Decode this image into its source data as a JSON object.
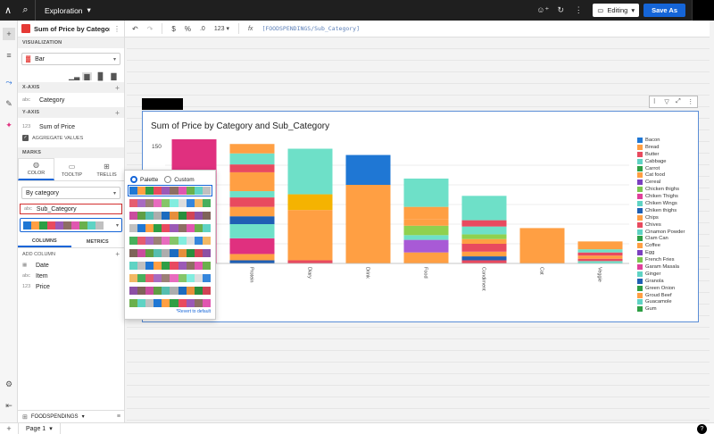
{
  "topbar": {
    "title": "Exploration",
    "mode": "Editing",
    "save": "Save As"
  },
  "toolbar": {
    "format_currency": "$",
    "format_percent": "%",
    "format_number": "123",
    "fx": "fx",
    "formula": "[FOODSPENDINGS/Sub_Category]"
  },
  "panel": {
    "title": "Sum of Price by Category a...",
    "visualization_label": "VISUALIZATION",
    "chart_type": "Bar",
    "xaxis_label": "X-AXIS",
    "xaxis_field_type": "abc",
    "xaxis_field": "Category",
    "yaxis_label": "Y-AXIS",
    "yaxis_field_type": "123",
    "yaxis_field": "Sum of Price",
    "aggregate": "AGGREGATE VALUES",
    "marks_label": "MARKS",
    "tabs": [
      "COLOR",
      "TOOLTIP",
      "TRELLIS"
    ],
    "color_by": "By category",
    "color_field_type": "abc",
    "color_field": "Sub_Category",
    "columns_tab": "COLUMNS",
    "metrics_tab": "METRICS",
    "add_column": "ADD COLUMN",
    "columns": [
      {
        "type": "",
        "name": "Date"
      },
      {
        "type": "abc",
        "name": "Item"
      },
      {
        "type": "123",
        "name": "Price"
      }
    ],
    "source": "FOODSPENDINGS"
  },
  "popup": {
    "palette": "Palette",
    "custom": "Custom",
    "revert": "*Revert to default"
  },
  "bottombar": {
    "page": "Page 1",
    "help": "?"
  },
  "colors": {
    "accent": "#1565d8",
    "selected_palette": [
      "#1f77d4",
      "#ff9f43",
      "#2e9e44",
      "#e84a5f",
      "#9b59b6",
      "#8d6e63",
      "#e056b0",
      "#6ab04c",
      "#5fd3c4",
      "#c0c0c0"
    ]
  },
  "chart_data": {
    "type": "bar",
    "stacked": true,
    "title": "Sum of Price by Category and Sub_Category",
    "ylim": [
      0,
      150
    ],
    "yticks": [
      150
    ],
    "categories": [
      "",
      "Protein",
      "Diary",
      "Drink",
      "Food",
      "Condiment",
      "Cat",
      "Veggie"
    ],
    "legend_entries": [
      "Bacon",
      "Bread",
      "Butter",
      "Cabbage",
      "Carrot",
      "Cat food",
      "Cereal",
      "Chicken thighs",
      "Chiken Thighs",
      "Chiken Wings",
      "Chiken thighs",
      "Chips",
      "Chives",
      "Cinamon Powder",
      "Clam Can",
      "Coffee",
      "Egg",
      "French Fries",
      "Garam Masala",
      "Ginger",
      "Granola",
      "Green Onion",
      "Groud Beef",
      "Guacamole",
      "Gum"
    ],
    "legend_colors": [
      "#1f77d4",
      "#ff9f43",
      "#e84a5f",
      "#5fd3c4",
      "#2e9e44",
      "#ff9f43",
      "#7b3fbf",
      "#7ac74f",
      "#e0409a",
      "#5fd3c4",
      "#1f5fb4",
      "#ff9f43",
      "#e84a5f",
      "#5fd3c4",
      "#2e9e44",
      "#ff9f43",
      "#7b3fbf",
      "#7ac74f",
      "#e0409a",
      "#5fd3c4",
      "#1f5fb4",
      "#2e9e44",
      "#ff9f43",
      "#5fd3c4",
      "#2e9e44"
    ],
    "stacks": [
      [
        {
          "c": "#e0307f",
          "v": 158
        }
      ],
      [
        {
          "c": "#1f5fb4",
          "v": 4
        },
        {
          "c": "#ff9f43",
          "v": 8
        },
        {
          "c": "#e0307f",
          "v": 20
        },
        {
          "c": "#6ee0c8",
          "v": 18
        },
        {
          "c": "#1f5fb4",
          "v": 10
        },
        {
          "c": "#ff9f43",
          "v": 12
        },
        {
          "c": "#e84a5f",
          "v": 12
        },
        {
          "c": "#6ee0c8",
          "v": 8
        },
        {
          "c": "#ff9f43",
          "v": 24
        },
        {
          "c": "#e84a5f",
          "v": 10
        },
        {
          "c": "#6ee0c8",
          "v": 14
        },
        {
          "c": "#ff9f43",
          "v": 12
        }
      ],
      [
        {
          "c": "#e84a5f",
          "v": 4
        },
        {
          "c": "#ff9f43",
          "v": 64
        },
        {
          "c": "#f5b301",
          "v": 20
        },
        {
          "c": "#6ee0c8",
          "v": 58
        }
      ],
      [
        {
          "c": "#ff9f43",
          "v": 100
        },
        {
          "c": "#1f77d4",
          "v": 38
        }
      ],
      [
        {
          "c": "#ff9f43",
          "v": 14
        },
        {
          "c": "#a85ad6",
          "v": 16
        },
        {
          "c": "#6ee0c8",
          "v": 6
        },
        {
          "c": "#8fd14f",
          "v": 12
        },
        {
          "c": "#ff9f43",
          "v": 8
        },
        {
          "c": "#ff9f43",
          "v": 16
        },
        {
          "c": "#6ee0c8",
          "v": 36
        }
      ],
      [
        {
          "c": "#e84a5f",
          "v": 4
        },
        {
          "c": "#1f5fb4",
          "v": 5
        },
        {
          "c": "#ff9f43",
          "v": 6
        },
        {
          "c": "#e84a5f",
          "v": 10
        },
        {
          "c": "#ff9f43",
          "v": 6
        },
        {
          "c": "#8fd14f",
          "v": 6
        },
        {
          "c": "#6ee0c8",
          "v": 10
        },
        {
          "c": "#e84a5f",
          "v": 8
        },
        {
          "c": "#6ee0c8",
          "v": 31
        }
      ],
      [
        {
          "c": "#ff9f43",
          "v": 45
        }
      ],
      [
        {
          "c": "#6ee0c8",
          "v": 3
        },
        {
          "c": "#e84a5f",
          "v": 3
        },
        {
          "c": "#ff9f43",
          "v": 4
        },
        {
          "c": "#e84a5f",
          "v": 4
        },
        {
          "c": "#6ee0c8",
          "v": 4
        },
        {
          "c": "#ff9f43",
          "v": 10
        }
      ]
    ]
  }
}
